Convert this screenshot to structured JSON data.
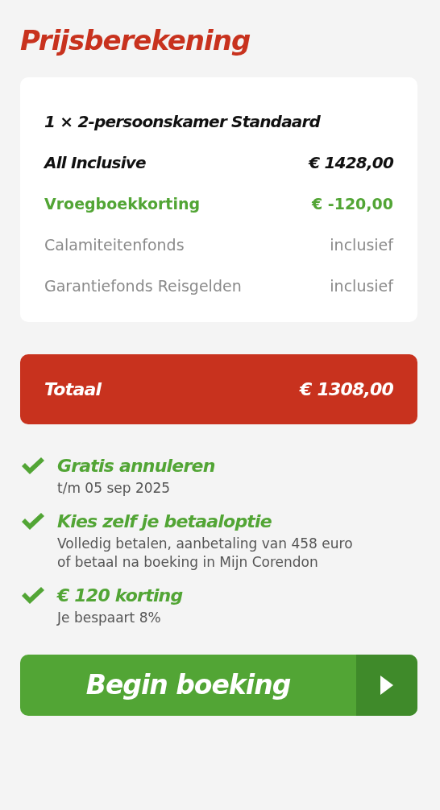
{
  "title": "Prijsberekening",
  "summary": {
    "lines": [
      {
        "kind": "heading",
        "label": "1 × 2-persoonskamer Standaard"
      },
      {
        "kind": "main",
        "label": "All Inclusive",
        "value": "€ 1428,00"
      },
      {
        "kind": "discount",
        "label": "Vroegboekkorting",
        "value": "€ -120,00"
      },
      {
        "kind": "included",
        "label": "Calamiteitenfonds",
        "value": "inclusief"
      },
      {
        "kind": "included",
        "label": "Garantiefonds Reisgelden",
        "value": "inclusief"
      }
    ]
  },
  "total": {
    "label": "Totaal",
    "value": "€ 1308,00"
  },
  "benefits": [
    {
      "title": "Gratis annuleren",
      "lines": [
        "t/m 05 sep 2025"
      ]
    },
    {
      "title": "Kies zelf je betaaloptie",
      "lines": [
        "Volledig betalen, aanbetaling van 458 euro",
        "of betaal na boeking in Mijn Corendon"
      ]
    },
    {
      "title": "€ 120 korting",
      "lines": [
        "Je bespaart 8%"
      ]
    }
  ],
  "button": {
    "label": "Begin boeking"
  }
}
